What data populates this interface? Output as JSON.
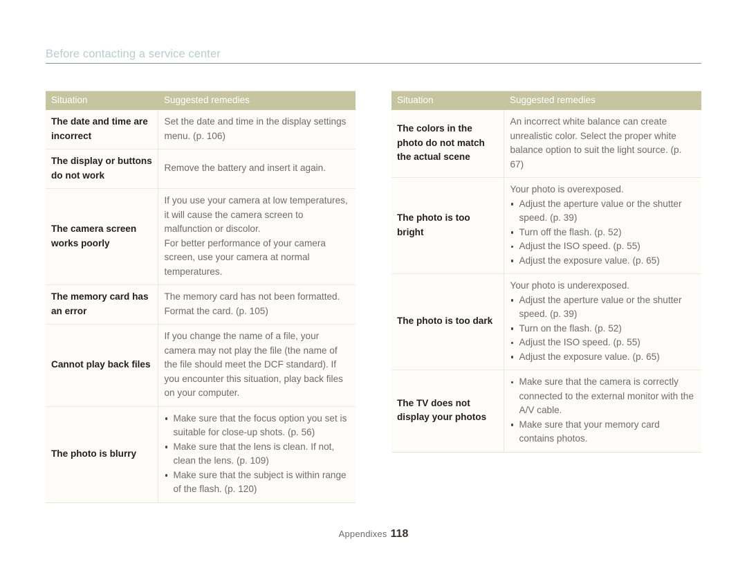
{
  "header": {
    "title": "Before contacting a service center"
  },
  "colors": {
    "header_title": "#b9cdd0",
    "table_head_bg": "#c6c5a0",
    "table_head_text": "#ffffff",
    "row_bg": "#fdfcf8",
    "situation_text": "#231f20",
    "remedy_text": "#6f6c68",
    "divider": "#eceadc",
    "rule": "#8e9496"
  },
  "tables": [
    {
      "id": "left",
      "columns": [
        "Situation",
        "Suggested remedies"
      ],
      "rows": [
        {
          "situation": "The date and time are incorrect",
          "remedy": {
            "type": "paragraph",
            "lines": [
              "Set the date and time in the display settings menu. (p. 106)"
            ]
          }
        },
        {
          "situation": "The display or buttons do not work",
          "remedy": {
            "type": "paragraph",
            "lines": [
              "Remove the battery and insert it again."
            ]
          }
        },
        {
          "situation": "The camera screen works poorly",
          "remedy": {
            "type": "paragraph",
            "lines": [
              "If you use your camera at low temperatures, it will cause the camera screen to malfunction or discolor.",
              "For better performance of your camera screen, use your camera at normal temperatures."
            ]
          }
        },
        {
          "situation": "The memory card has an error",
          "remedy": {
            "type": "paragraph",
            "lines": [
              "The memory card has not been formatted. Format the card. (p. 105)"
            ]
          }
        },
        {
          "situation": "Cannot play back files",
          "remedy": {
            "type": "paragraph",
            "lines": [
              "If you change the name of a file, your camera may not play the file (the name of the file should meet the DCF standard). If you encounter this situation, play back files on your computer."
            ]
          }
        },
        {
          "situation": "The photo is blurry",
          "remedy": {
            "type": "list",
            "items": [
              "Make sure that the focus option you set is suitable for close-up shots. (p. 56)",
              "Make sure that the lens is clean. If not, clean the lens. (p. 109)",
              "Make sure that the subject is within range of the flash. (p. 120)"
            ]
          }
        }
      ]
    },
    {
      "id": "right",
      "columns": [
        "Situation",
        "Suggested remedies"
      ],
      "rows": [
        {
          "situation": "The colors in the photo do not match the actual scene",
          "remedy": {
            "type": "paragraph",
            "lines": [
              "An incorrect white balance can create unrealistic color. Select the proper white balance option to suit the light source. (p. 67)"
            ]
          }
        },
        {
          "situation": "The photo is too bright",
          "remedy": {
            "type": "lead-list",
            "lead": "Your photo is overexposed.",
            "items": [
              "Adjust the aperture value or the shutter speed. (p. 39)",
              "Turn off the flash. (p. 52)",
              "Adjust the ISO speed. (p. 55)",
              "Adjust the exposure value. (p. 65)"
            ]
          }
        },
        {
          "situation": "The photo is too dark",
          "remedy": {
            "type": "lead-list",
            "lead": "Your photo is underexposed.",
            "items": [
              "Adjust the aperture value or the shutter speed. (p. 39)",
              "Turn on the flash. (p. 52)",
              "Adjust the ISO speed. (p. 55)",
              "Adjust the exposure value. (p. 65)"
            ]
          }
        },
        {
          "situation": "The TV does not display your photos",
          "remedy": {
            "type": "list",
            "items": [
              "Make sure that the camera is correctly connected to the external monitor with the A/V cable.",
              "Make sure that your memory card contains photos."
            ]
          }
        }
      ]
    }
  ],
  "footer": {
    "label": "Appendixes",
    "page_number": "118"
  }
}
